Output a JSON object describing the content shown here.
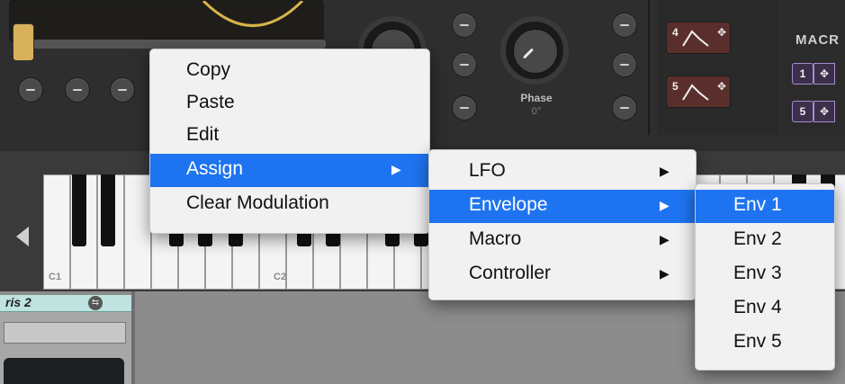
{
  "knobs": [
    {
      "label": "Phase",
      "value": "0°"
    }
  ],
  "envelopes": [
    {
      "number": "4"
    },
    {
      "number": "5"
    }
  ],
  "macro": {
    "title": "MACR",
    "tags": [
      "1",
      "5"
    ]
  },
  "keyboard": {
    "labels": [
      "C1",
      "C2"
    ]
  },
  "preset": {
    "name": "ris 2"
  },
  "context_menu": {
    "items": [
      {
        "label": "Copy"
      },
      {
        "label": "Paste"
      },
      {
        "label": "Edit"
      },
      {
        "label": "Assign",
        "arrow": "▶"
      },
      {
        "label": "Clear Modulation"
      }
    ]
  },
  "assign_menu": {
    "items": [
      {
        "label": "LFO",
        "arrow": "▶"
      },
      {
        "label": "Envelope",
        "arrow": "▶"
      },
      {
        "label": "Macro",
        "arrow": "▶"
      },
      {
        "label": "Controller",
        "arrow": "▶"
      }
    ]
  },
  "envelope_menu": {
    "items": [
      {
        "label": "Env 1"
      },
      {
        "label": "Env 2"
      },
      {
        "label": "Env 3"
      },
      {
        "label": "Env 4"
      },
      {
        "label": "Env 5"
      }
    ]
  },
  "colors": {
    "highlight": "#1e74f0",
    "menu_bg": "#f1f1f1",
    "env_box": "#5a2f2b",
    "macro_border": "#a68ccf",
    "preset_header": "#bfe3de"
  }
}
